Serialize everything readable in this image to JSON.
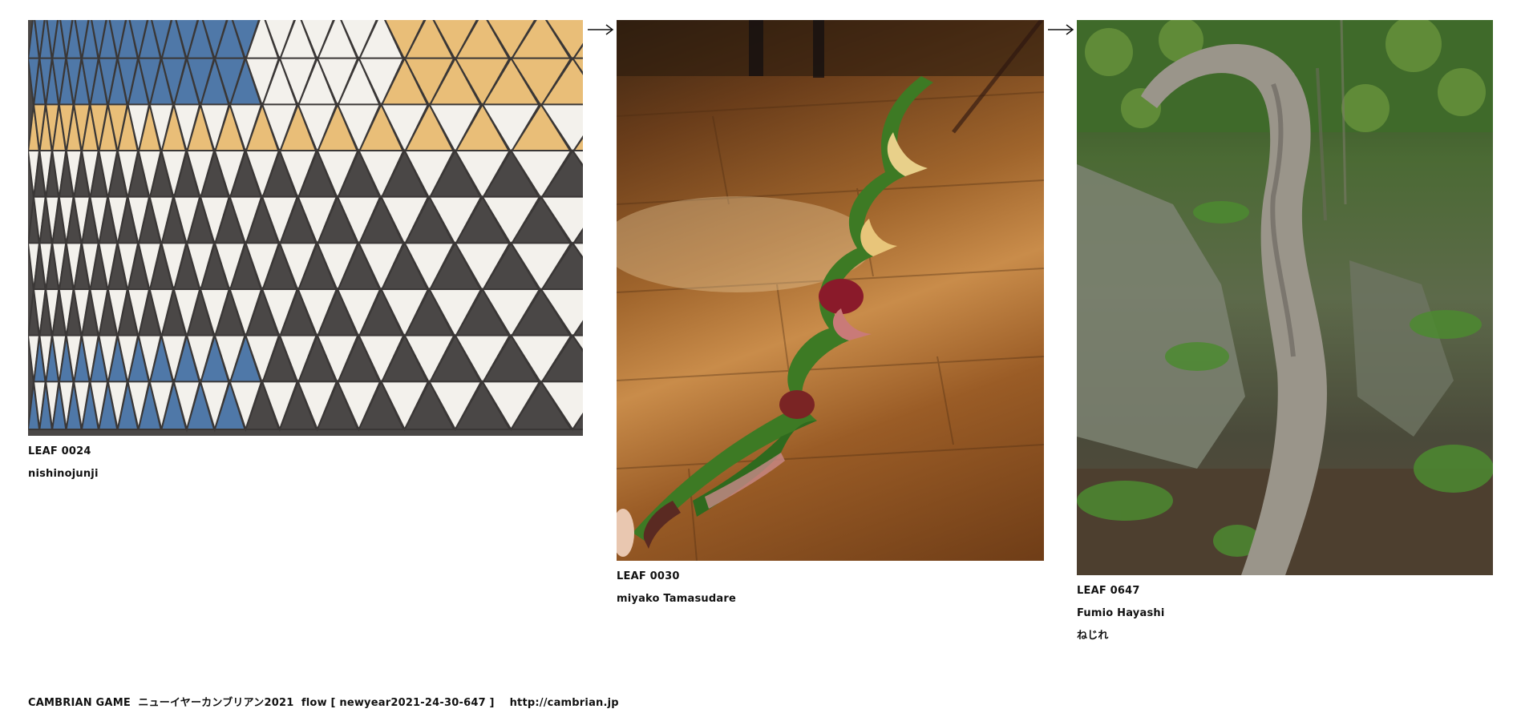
{
  "items": [
    {
      "image_subject": "triangle tile wall",
      "title": "LEAF 0024",
      "author": "nishinojunji",
      "note": ""
    },
    {
      "image_subject": "twisted leaf over wooden floor",
      "title": "LEAF 0030",
      "author": "miyako Tamasudare",
      "note": ""
    },
    {
      "image_subject": "twisted vine in forest",
      "title": "LEAF 0647",
      "author": "Fumio Hayashi",
      "note": "ねじれ"
    }
  ],
  "arrow_icon": "right-arrow-icon",
  "footer": {
    "brand": "CAMBRIAN GAME",
    "event": "ニューイヤーカンブリアン2021",
    "flow": "flow [ newyear2021-24-30-647 ]",
    "url": "http://cambrian.jp"
  },
  "colors": {
    "tile_blue": "#4f78a8",
    "tile_yellow": "#e9be78",
    "tile_white": "#f3f1ec",
    "tile_dark": "#4a4746",
    "text": "#111111"
  }
}
